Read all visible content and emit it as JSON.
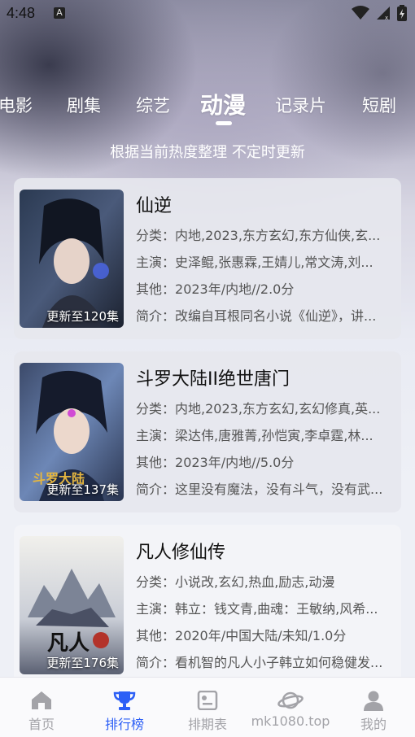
{
  "status": {
    "time": "4:48",
    "a_icon": "A"
  },
  "tabs": [
    "电影",
    "剧集",
    "综艺",
    "动漫",
    "记录片",
    "短剧"
  ],
  "active_tab": "动漫",
  "subtitle": "根据当前热度整理 不定时更新",
  "labels": {
    "category": "分类：",
    "cast": "主演：",
    "other": "其他：",
    "intro": "简介："
  },
  "items": [
    {
      "title": "仙逆",
      "update": "更新至120集",
      "category": "内地,2023,东方玄幻,东方仙侠,玄...",
      "cast": "史泽鲲,张惠霖,王婧儿,常文涛,刘...",
      "other": "2023年/内地//2.0分",
      "intro": "改编自耳根同名小说《仙逆》，讲..."
    },
    {
      "title": "斗罗大陆II绝世唐门",
      "update": "更新至137集",
      "category": "内地,2023,东方玄幻,玄幻修真,英...",
      "cast": "梁达伟,唐雅菁,孙恺寅,李卓霆,林...",
      "other": "2023年/内地//5.0分",
      "intro": "这里没有魔法，没有斗气，没有武..."
    },
    {
      "title": "凡人修仙传",
      "update": "更新至176集",
      "category": "小说改,玄幻,热血,励志,动漫",
      "cast": "韩立：钱文青,曲魂：王敏纳,风希...",
      "other": "2020年/中国大陆/未知/1.0分",
      "intro": "看机智的凡人小子韩立如何稳健发..."
    }
  ],
  "bottom_nav": [
    {
      "label": "首页",
      "icon": "home-icon"
    },
    {
      "label": "排行榜",
      "icon": "trophy-icon"
    },
    {
      "label": "排期表",
      "icon": "schedule-icon"
    },
    {
      "label": "mk1080.top",
      "icon": "planet-icon"
    },
    {
      "label": "我的",
      "icon": "user-icon"
    }
  ],
  "colors": {
    "accent": "#2c5ff6",
    "nav_inactive": "#a3a3a8"
  }
}
